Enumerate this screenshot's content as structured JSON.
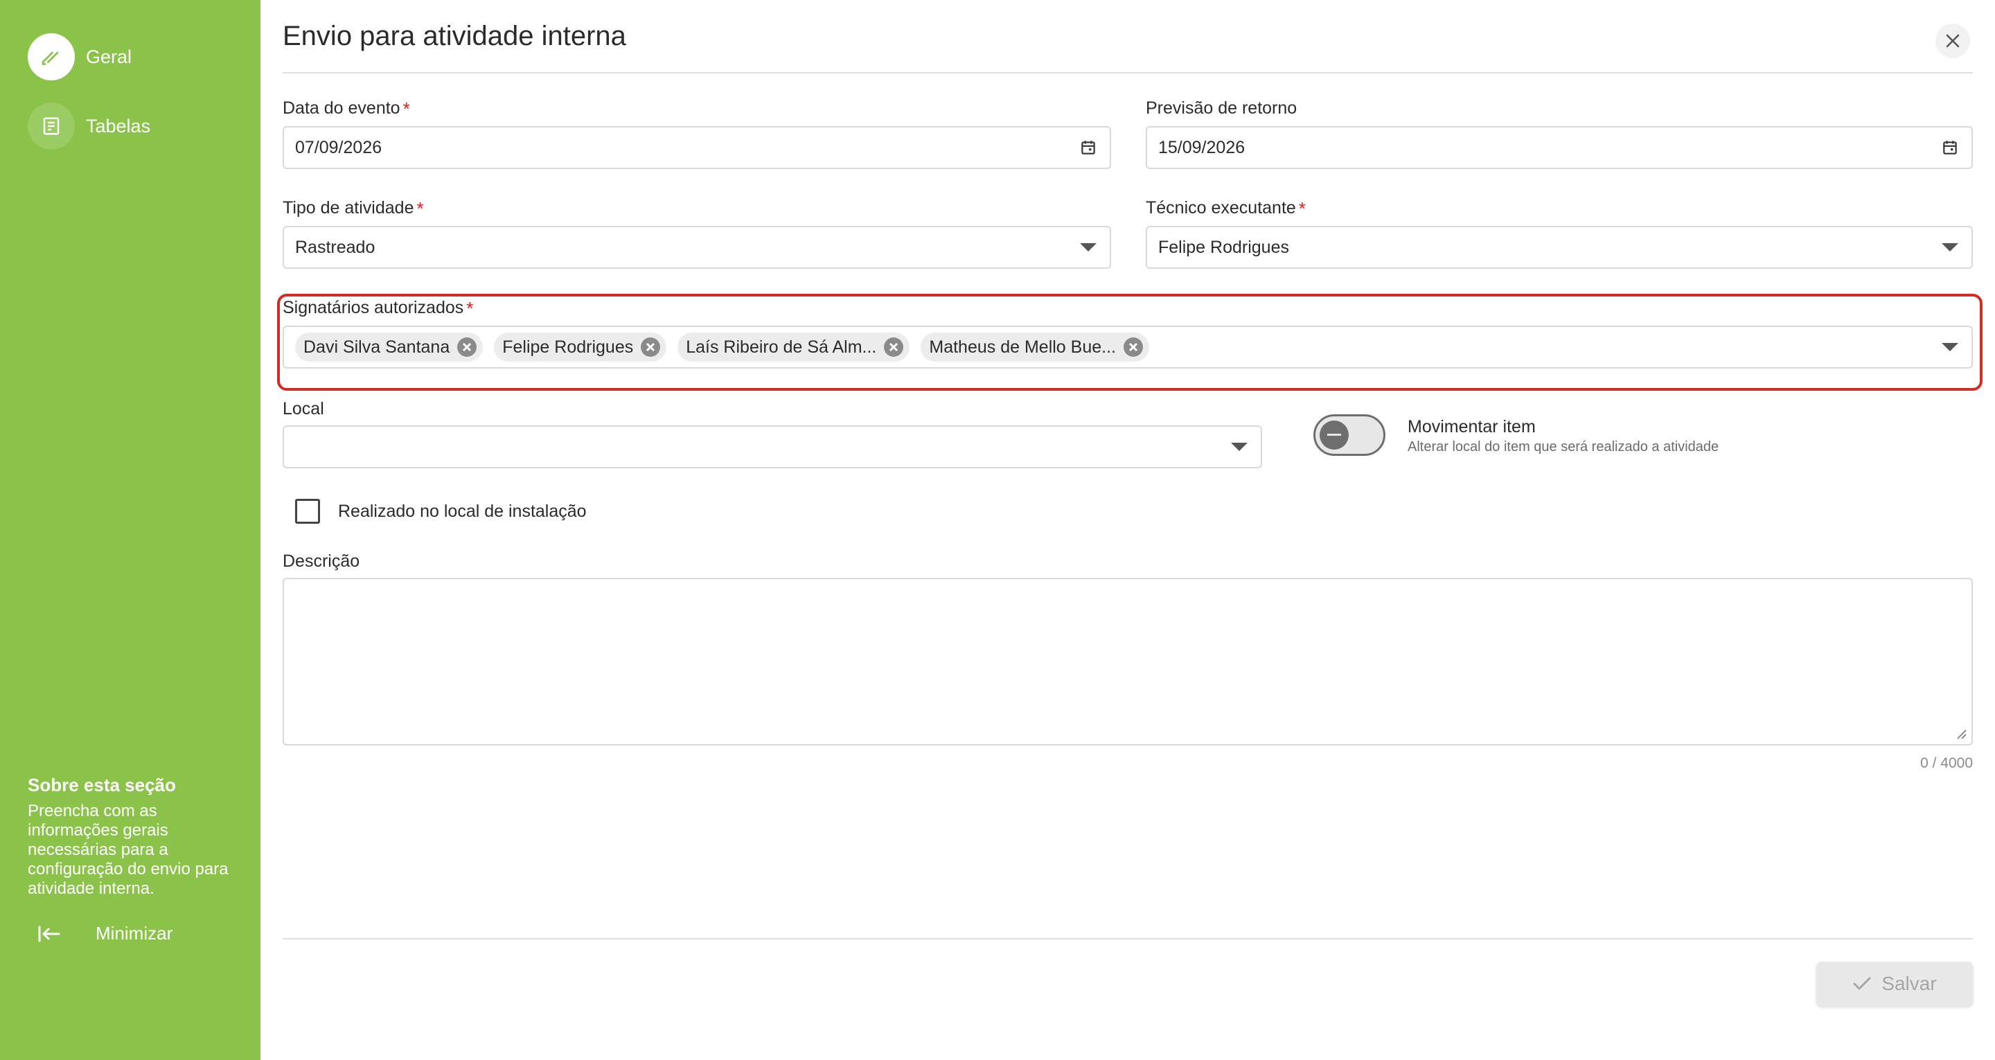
{
  "sidebar": {
    "items": [
      {
        "label": "Geral",
        "icon": "pen-icon",
        "active": true
      },
      {
        "label": "Tabelas",
        "icon": "table-icon",
        "active": false
      }
    ],
    "about_title": "Sobre esta seção",
    "about_text": "Preencha com as informações gerais necessárias para a configuração do envio para atividade interna.",
    "minimize_label": "Minimizar"
  },
  "dialog": {
    "title": "Envio para atividade interna"
  },
  "form": {
    "event_date": {
      "label": "Data do evento",
      "required_mark": "*",
      "value": "07/09/2026"
    },
    "return_date": {
      "label": "Previsão de retorno",
      "value": "15/09/2026"
    },
    "activity_type": {
      "label": "Tipo de atividade",
      "required_mark": "*",
      "value": "Rastreado"
    },
    "technician": {
      "label": "Técnico executante",
      "required_mark": "*",
      "value": "Felipe Rodrigues"
    },
    "signatories": {
      "label": "Signatários autorizados",
      "required_mark": "*",
      "chips": [
        "Davi Silva Santana",
        "Felipe Rodrigues",
        "Laís Ribeiro de Sá Alm...",
        "Matheus de Mello Bue..."
      ]
    },
    "location": {
      "label": "Local",
      "value": ""
    },
    "move_item": {
      "title": "Movimentar item",
      "subtitle": "Alterar local do item que será realizado a atividade",
      "on": false
    },
    "on_site": {
      "label": "Realizado no local de instalação",
      "checked": false
    },
    "description": {
      "label": "Descrição",
      "value": "",
      "counter": "0 / 4000"
    }
  },
  "footer": {
    "save_label": "Salvar"
  },
  "colors": {
    "sidebar": "#8bc34a",
    "highlight": "#d52b25",
    "required": "#e02020"
  }
}
